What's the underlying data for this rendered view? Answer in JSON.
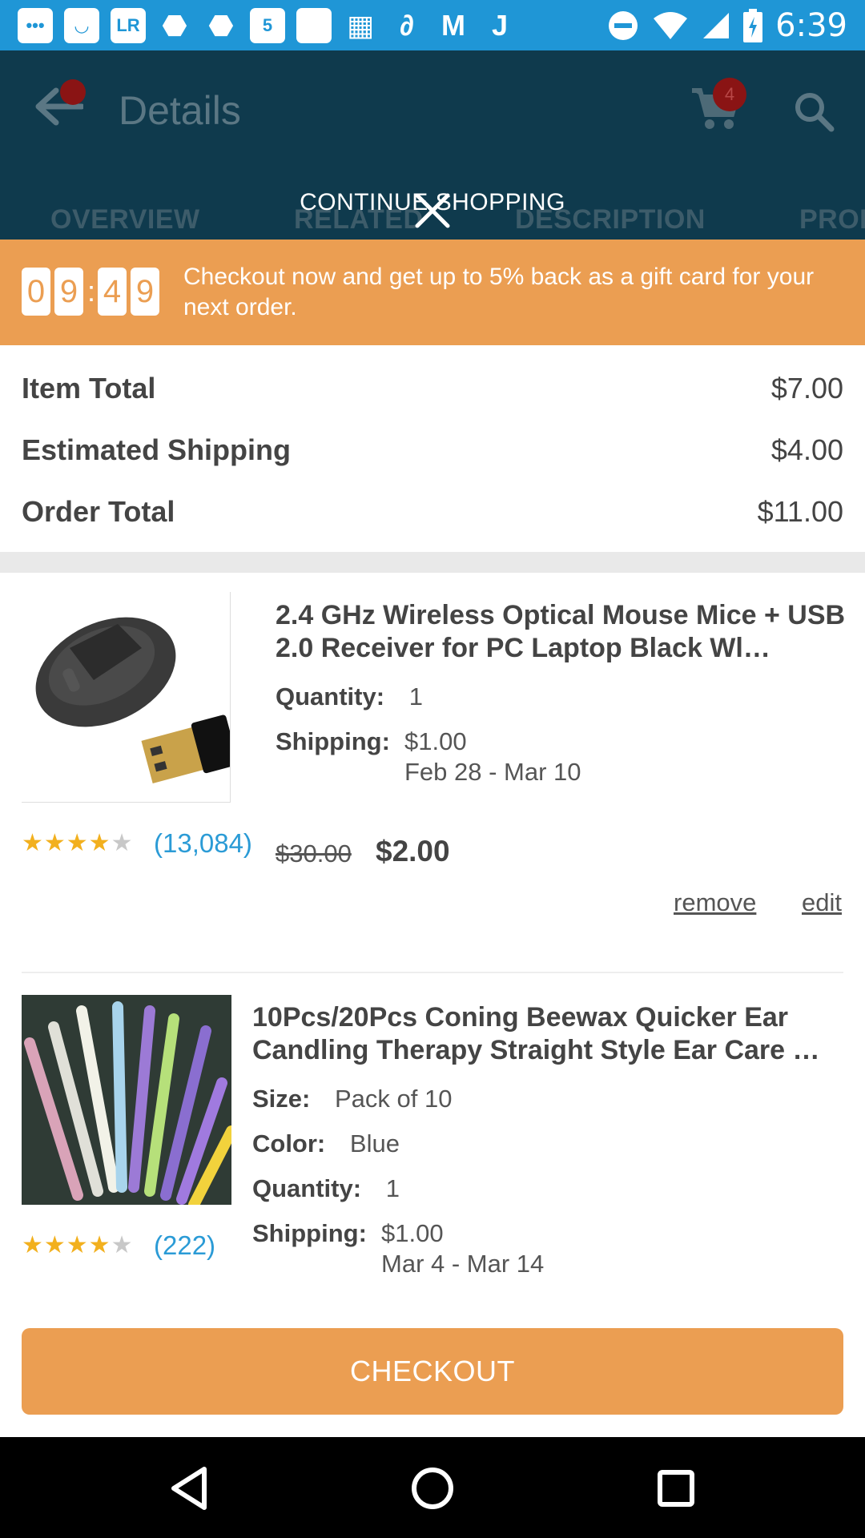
{
  "status_bar": {
    "time": "6:39",
    "icons": [
      "LR"
    ]
  },
  "app_bar": {
    "title": "Details",
    "cart_count": "4",
    "tabs": [
      "OVERVIEW",
      "RELATED",
      "DESCRIPTION",
      "PROD"
    ],
    "continue_label": "CONTINUE SHOPPING"
  },
  "promo": {
    "timer_digits": [
      "0",
      "9",
      "4",
      "9"
    ],
    "text": "Checkout now and get up to 5% back as a gift card for your next order."
  },
  "summary": {
    "rows": [
      {
        "label": "Item Total",
        "value": "$7.00"
      },
      {
        "label": "Estimated Shipping",
        "value": "$4.00"
      },
      {
        "label": "Order Total",
        "value": "$11.00"
      }
    ]
  },
  "items": [
    {
      "title": "2.4 GHz Wireless Optical Mouse Mice + USB 2.0 Receiver for PC Laptop Black Wl…",
      "quantity_label": "Quantity:",
      "quantity": "1",
      "shipping_label": "Shipping:",
      "shipping_price": "$1.00",
      "shipping_dates": "Feb 28 - Mar 10",
      "rating": 4,
      "reviews": "(13,084)",
      "old_price": "$30.00",
      "price": "$2.00",
      "remove_label": "remove",
      "edit_label": "edit"
    },
    {
      "title": "10Pcs/20Pcs Coning Beewax Quicker Ear Candling Therapy Straight Style Ear Care …",
      "size_label": "Size:",
      "size": "Pack of 10",
      "color_label": "Color:",
      "color": "Blue",
      "quantity_label": "Quantity:",
      "quantity": "1",
      "shipping_label": "Shipping:",
      "shipping_price": "$1.00",
      "shipping_dates": "Mar 4 - Mar 14",
      "rating": 4,
      "reviews": "(222)"
    }
  ],
  "checkout_label": "CHECKOUT",
  "colors": {
    "accent_orange": "#eb9e52",
    "status_blue": "#1f96d6",
    "link_blue": "#2b9bd6",
    "star_gold": "#f2b01e"
  }
}
